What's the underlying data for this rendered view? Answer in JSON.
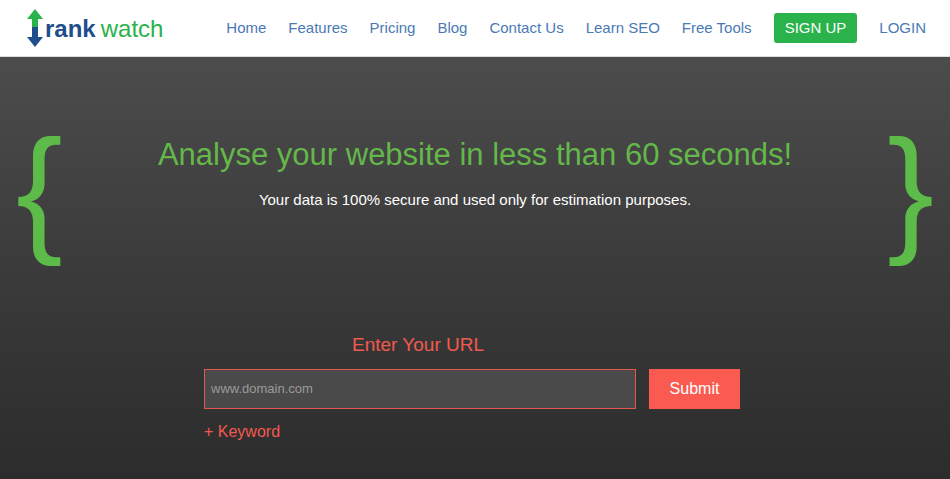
{
  "logo": {
    "first": "rank",
    "second": "watch"
  },
  "nav": [
    {
      "label": "Home",
      "kind": "link"
    },
    {
      "label": "Features",
      "kind": "link"
    },
    {
      "label": "Pricing",
      "kind": "link"
    },
    {
      "label": "Blog",
      "kind": "link"
    },
    {
      "label": "Contact Us",
      "kind": "link"
    },
    {
      "label": "Learn SEO",
      "kind": "link"
    },
    {
      "label": "Free Tools",
      "kind": "link"
    },
    {
      "label": "SIGN UP",
      "kind": "button"
    },
    {
      "label": "LOGIN",
      "kind": "link"
    }
  ],
  "hero": {
    "brace_left": "{",
    "brace_right": "}",
    "title": "Analyse your website in less than 60 seconds!",
    "subtitle": "Your data is 100% secure and used only for estimation purposes."
  },
  "form": {
    "label": "Enter Your URL",
    "placeholder": "www.domain.com",
    "submit": "Submit",
    "keyword": "+ Keyword"
  }
}
